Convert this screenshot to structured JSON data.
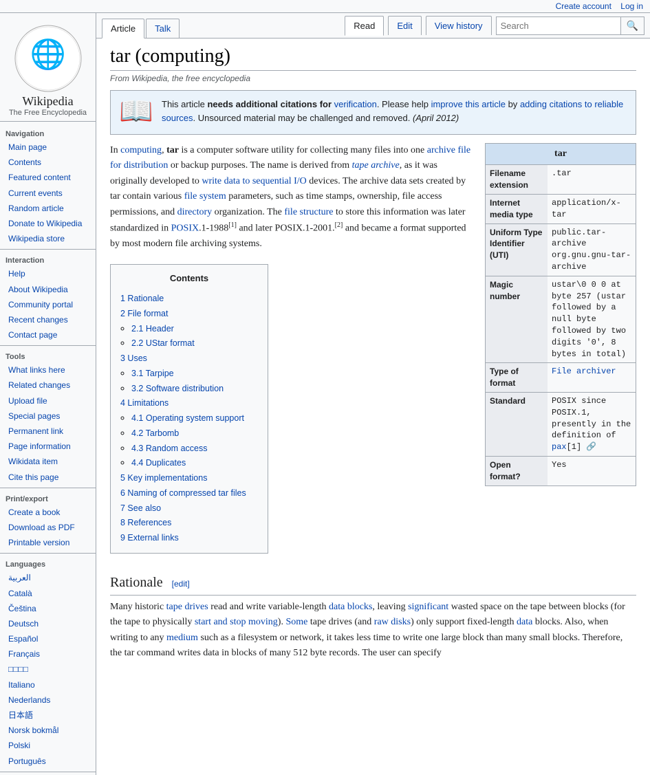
{
  "topbar": {
    "create_account": "Create account",
    "log_in": "Log in"
  },
  "sidebar": {
    "logo_title": "Wikipedia",
    "logo_subtitle": "The Free Encyclopedia",
    "navigation": {
      "title": "Navigation",
      "items": [
        {
          "label": "Main page",
          "href": "#"
        },
        {
          "label": "Contents",
          "href": "#"
        },
        {
          "label": "Featured content",
          "href": "#"
        },
        {
          "label": "Current events",
          "href": "#"
        },
        {
          "label": "Random article",
          "href": "#"
        },
        {
          "label": "Donate to Wikipedia",
          "href": "#"
        },
        {
          "label": "Wikipedia store",
          "href": "#"
        }
      ]
    },
    "interaction": {
      "title": "Interaction",
      "items": [
        {
          "label": "Help",
          "href": "#"
        },
        {
          "label": "About Wikipedia",
          "href": "#"
        },
        {
          "label": "Community portal",
          "href": "#"
        },
        {
          "label": "Recent changes",
          "href": "#"
        },
        {
          "label": "Contact page",
          "href": "#"
        }
      ]
    },
    "tools": {
      "title": "Tools",
      "items": [
        {
          "label": "What links here",
          "href": "#"
        },
        {
          "label": "Related changes",
          "href": "#"
        },
        {
          "label": "Upload file",
          "href": "#"
        },
        {
          "label": "Special pages",
          "href": "#"
        },
        {
          "label": "Permanent link",
          "href": "#"
        },
        {
          "label": "Page information",
          "href": "#"
        },
        {
          "label": "Wikidata item",
          "href": "#"
        },
        {
          "label": "Cite this page",
          "href": "#"
        }
      ]
    },
    "print_export": {
      "title": "Print/export",
      "items": [
        {
          "label": "Create a book",
          "href": "#"
        },
        {
          "label": "Download as PDF",
          "href": "#"
        },
        {
          "label": "Printable version",
          "href": "#"
        }
      ]
    },
    "languages": {
      "title": "Languages",
      "items": [
        {
          "label": "العربية",
          "href": "#"
        },
        {
          "label": "Català",
          "href": "#"
        },
        {
          "label": "Čeština",
          "href": "#"
        },
        {
          "label": "Deutsch",
          "href": "#"
        },
        {
          "label": "Español",
          "href": "#"
        },
        {
          "label": "Français",
          "href": "#"
        },
        {
          "label": "□□□□",
          "href": "#"
        },
        {
          "label": "Italiano",
          "href": "#"
        },
        {
          "label": "Nederlands",
          "href": "#"
        },
        {
          "label": "日本語",
          "href": "#"
        },
        {
          "label": "Norsk bokmål",
          "href": "#"
        },
        {
          "label": "Polski",
          "href": "#"
        },
        {
          "label": "Português",
          "href": "#"
        }
      ]
    }
  },
  "tabs": {
    "left": [
      {
        "label": "Article",
        "active": true
      },
      {
        "label": "Talk",
        "active": false
      }
    ],
    "right": [
      {
        "label": "Read",
        "active": true
      },
      {
        "label": "Edit",
        "active": false
      },
      {
        "label": "View history",
        "active": false
      }
    ]
  },
  "search": {
    "placeholder": "Search",
    "button_icon": "🔍"
  },
  "article": {
    "title": "tar (computing)",
    "subtitle": "From Wikipedia, the free encyclopedia",
    "notice": {
      "icon": "📖",
      "text_1": "This article ",
      "bold": "needs additional citations for",
      "link_bold": "verification",
      "text_2": ". Please help ",
      "link_improve": "improve this article",
      "text_3": " by ",
      "link_citations": "adding citations to reliable sources",
      "text_4": ". Unsourced material may be challenged and removed.",
      "date": "(April 2012)"
    },
    "infobox": {
      "title": "tar",
      "rows": [
        {
          "label": "Filename extension",
          "value": ".tar"
        },
        {
          "label": "Internet media type",
          "value": "application/x-tar"
        },
        {
          "label": "Uniform Type Identifier (UTI)",
          "value": "public.tar-archive org.gnu.gnu-tar-archive"
        },
        {
          "label": "Magic number",
          "value": "ustar\\0 0 0 at byte 257 (ustar followed by a null byte followed by two digits '0', 8 bytes in total)"
        },
        {
          "label": "Type of format",
          "value": "File archiver"
        },
        {
          "label": "Standard",
          "value": "POSIX since POSIX.1, presently in the definition of pax[1]"
        },
        {
          "label": "Open format?",
          "value": "Yes"
        }
      ]
    },
    "intro": "In computing, tar is a computer software utility for collecting many files into one archive file for distribution or backup purposes. The name is derived from tape archive, as it was originally developed to write data to sequential I/O devices. The archive data sets created by tar contain various file system parameters, such as time stamps, ownership, file access permissions, and directory organization. The file structure to store this information was later standardized in POSIX.1-1988[1] and later POSIX.1-2001.[2] and became a format supported by most modern file archiving systems.",
    "toc": {
      "title": "Contents",
      "items": [
        {
          "num": "1",
          "label": "Rationale",
          "sub": []
        },
        {
          "num": "2",
          "label": "File format",
          "sub": [
            {
              "num": "2.1",
              "label": "Header"
            },
            {
              "num": "2.2",
              "label": "UStar format"
            }
          ]
        },
        {
          "num": "3",
          "label": "Uses",
          "sub": [
            {
              "num": "3.1",
              "label": "Tarpipe"
            },
            {
              "num": "3.2",
              "label": "Software distribution"
            }
          ]
        },
        {
          "num": "4",
          "label": "Limitations",
          "sub": [
            {
              "num": "4.1",
              "label": "Operating system support"
            },
            {
              "num": "4.2",
              "label": "Tarbomb"
            },
            {
              "num": "4.3",
              "label": "Random access"
            },
            {
              "num": "4.4",
              "label": "Duplicates"
            }
          ]
        },
        {
          "num": "5",
          "label": "Key implementations",
          "sub": []
        },
        {
          "num": "6",
          "label": "Naming of compressed tar files",
          "sub": []
        },
        {
          "num": "7",
          "label": "See also",
          "sub": []
        },
        {
          "num": "8",
          "label": "References",
          "sub": []
        },
        {
          "num": "9",
          "label": "External links",
          "sub": []
        }
      ]
    },
    "rationale_heading": "Rationale",
    "rationale_edit": "[edit]",
    "rationale_text": "Many historic tape drives read and write variable-length data blocks, leaving significant wasted space on the tape between blocks (for the tape to physically start and stop moving). Some tape drives (and raw disks) only support fixed-length data blocks. Also, when writing to any medium such as a filesystem or network, it takes less time to write one large block than many small blocks. Therefore, the tar command writes data in blocks of many 512 byte records. The user can specify"
  }
}
